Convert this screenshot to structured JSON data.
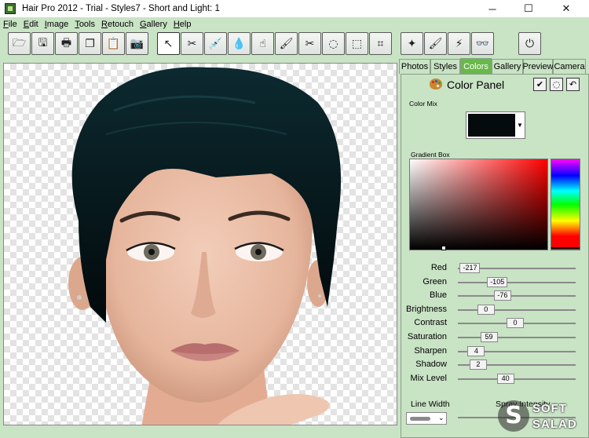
{
  "window": {
    "title": "Hair Pro 2012 - Trial - Styles7 - Short and Light: 1",
    "minimize": "─",
    "maximize": "☐",
    "close": "✕"
  },
  "menu": [
    {
      "pre": "",
      "u": "F",
      "post": "ile"
    },
    {
      "pre": "",
      "u": "E",
      "post": "dit"
    },
    {
      "pre": "",
      "u": "I",
      "post": "mage"
    },
    {
      "pre": "",
      "u": "T",
      "post": "ools"
    },
    {
      "pre": "",
      "u": "R",
      "post": "etouch"
    },
    {
      "pre": "",
      "u": "G",
      "post": "allery"
    },
    {
      "pre": "",
      "u": "H",
      "post": "elp"
    }
  ],
  "toolbar": {
    "buttons": [
      {
        "name": "open-folder-icon",
        "glyph": "🗁"
      },
      {
        "name": "save-icon",
        "glyph": "🖫"
      },
      {
        "name": "print-icon",
        "glyph": "🖶"
      },
      {
        "name": "copy-icon",
        "glyph": "❐"
      },
      {
        "name": "paste-icon",
        "glyph": "📋"
      },
      {
        "name": "camera-icon",
        "glyph": "📷"
      },
      {
        "name": "pointer-icon",
        "glyph": "↖"
      },
      {
        "name": "scissors-icon",
        "glyph": "✂"
      },
      {
        "name": "dropper-icon",
        "glyph": "💉"
      },
      {
        "name": "water-drop-icon",
        "glyph": "💧"
      },
      {
        "name": "smudge-icon",
        "glyph": "☝"
      },
      {
        "name": "brush-icon",
        "glyph": "🖌"
      },
      {
        "name": "cut-tool-icon",
        "glyph": "✂"
      },
      {
        "name": "lasso-icon",
        "glyph": "◌"
      },
      {
        "name": "select-rect-icon",
        "glyph": "⬚"
      },
      {
        "name": "crop-icon",
        "glyph": "⌗"
      },
      {
        "name": "magic-wand-icon",
        "glyph": "✦"
      },
      {
        "name": "paint-brush-icon",
        "glyph": "🖌"
      },
      {
        "name": "flash-icon",
        "glyph": "⚡"
      },
      {
        "name": "glasses-icon",
        "glyph": "👓"
      },
      {
        "name": "power-icon",
        "glyph": "⏻"
      }
    ]
  },
  "tabs": [
    {
      "label": "Photos",
      "active": false
    },
    {
      "label": "Styles",
      "active": false
    },
    {
      "label": "Colors",
      "active": true
    },
    {
      "label": "Gallery",
      "active": false
    },
    {
      "label": "Preview",
      "active": false
    },
    {
      "label": "Camera",
      "active": false
    }
  ],
  "panel": {
    "title": "Color Panel",
    "color_mix_label": "Color Mix",
    "gradient_label": "Gradient Box",
    "current_color": "#050a0c",
    "sliders": [
      {
        "label": "Red",
        "value": "-217",
        "level": 0.02
      },
      {
        "label": "Green",
        "value": "-105",
        "level": 0.3
      },
      {
        "label": "Blue",
        "value": "-76",
        "level": 0.37
      },
      {
        "label": "Brightness",
        "value": "0",
        "level": 0.2
      },
      {
        "label": "Contrast",
        "value": "0",
        "level": 0.5
      },
      {
        "label": "Saturation",
        "value": "59",
        "level": 0.23
      },
      {
        "label": "Sharpen",
        "value": "4",
        "level": 0.1
      },
      {
        "label": "Shadow",
        "value": "2",
        "level": 0.12
      },
      {
        "label": "Mix Level",
        "value": "40",
        "level": 0.4
      }
    ],
    "line_width_label": "Line Width",
    "spray_label": "Spray Intensity"
  },
  "watermark": {
    "line1": "SOFT",
    "line2": "SALAD",
    "glyph": "S"
  }
}
